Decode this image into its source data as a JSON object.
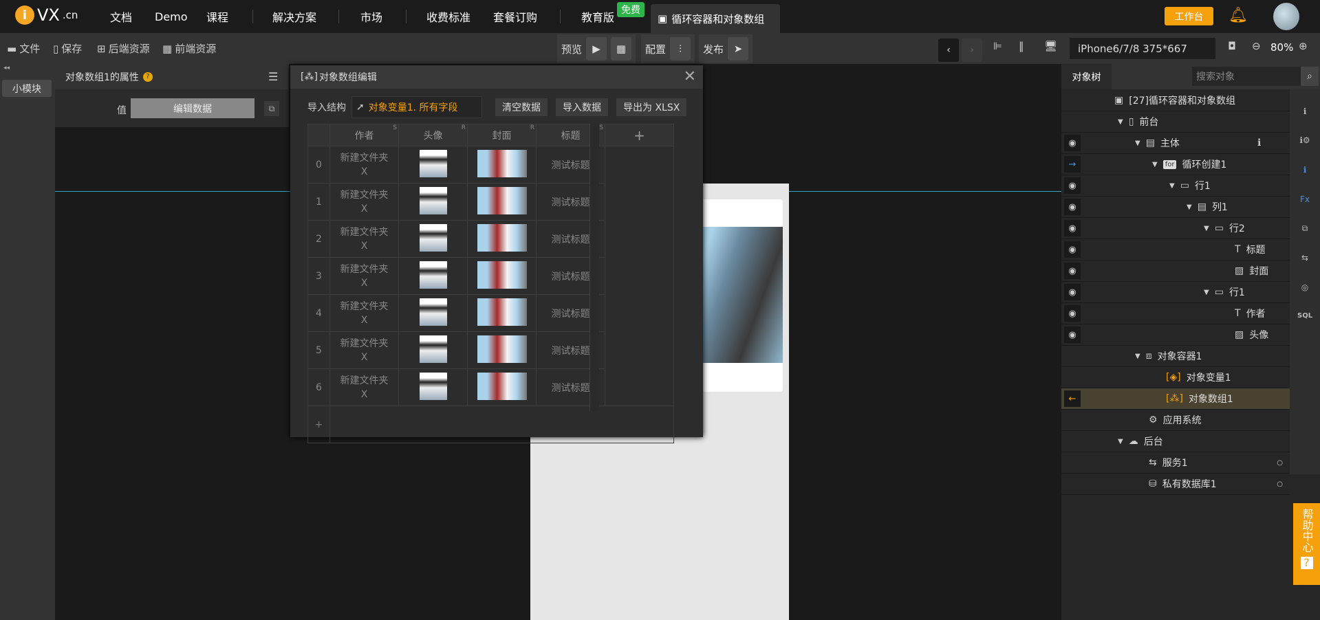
{
  "header": {
    "logo": "VX",
    "logo_suffix": ".cn",
    "nav": [
      "文档",
      "Demo",
      "课程",
      "解决方案",
      "市场",
      "收费标准",
      "套餐订购",
      "教育版"
    ],
    "free_badge": "免费",
    "active_tab": "循环容器和对象数组",
    "workbench": "工作台"
  },
  "toolbar": {
    "file": "文件",
    "save": "保存",
    "backend_res": "后端资源",
    "frontend_res": "前端资源",
    "preview": "预览",
    "config": "配置",
    "publish": "发布",
    "device": "iPhone6/7/8 375*667",
    "zoom": "80%"
  },
  "left": {
    "small_module": "小模块",
    "props_title": "对象数组1的属性",
    "value_label": "值",
    "edit_data": "编辑数据"
  },
  "dialog": {
    "title": "对象数组编辑",
    "import_label": "导入结构",
    "import_value": "对象变量1. 所有字段",
    "clear": "清空数据",
    "import_data": "导入数据",
    "export": "导出为 XLSX",
    "columns": [
      {
        "name": "作者",
        "type": "S"
      },
      {
        "name": "头像",
        "type": "R"
      },
      {
        "name": "封面",
        "type": "R"
      },
      {
        "name": "标题",
        "type": "S"
      }
    ],
    "add_col": "+",
    "add_row": "+",
    "rows": [
      {
        "i": "0",
        "author": "新建文件夹X",
        "title": "测试标题"
      },
      {
        "i": "1",
        "author": "新建文件夹X",
        "title": "测试标题"
      },
      {
        "i": "2",
        "author": "新建文件夹X",
        "title": "测试标题"
      },
      {
        "i": "3",
        "author": "新建文件夹X",
        "title": "测试标题"
      },
      {
        "i": "4",
        "author": "新建文件夹X",
        "title": "测试标题"
      },
      {
        "i": "5",
        "author": "新建文件夹X",
        "title": "测试标题"
      },
      {
        "i": "6",
        "author": "新建文件夹X",
        "title": "测试标题"
      }
    ]
  },
  "right": {
    "tab": "对象树",
    "search_placeholder": "搜索对象",
    "tree": [
      {
        "label": "[27]循环容器和对象数组",
        "icon": "page-icon",
        "depth": 0,
        "eye": false
      },
      {
        "label": "前台",
        "icon": "tablet-icon",
        "depth": 1,
        "tri": true
      },
      {
        "label": "主体",
        "icon": "column-icon",
        "depth": 2,
        "tri": true,
        "eye": true
      },
      {
        "label": "循环创建1",
        "icon": "for-icon",
        "depth": 3,
        "tri": true,
        "arrow": "right"
      },
      {
        "label": "行1",
        "icon": "row-icon",
        "depth": 4,
        "tri": true,
        "eye": true
      },
      {
        "label": "列1",
        "icon": "column-icon",
        "depth": 5,
        "tri": true,
        "eye": true
      },
      {
        "label": "行2",
        "icon": "row-icon",
        "depth": 6,
        "tri": true,
        "eye": true
      },
      {
        "label": "标题",
        "icon": "text-icon",
        "depth": 7,
        "eye": true
      },
      {
        "label": "封面",
        "icon": "image-icon",
        "depth": 7,
        "eye": true
      },
      {
        "label": "行1",
        "icon": "row-icon",
        "depth": 6,
        "tri": true,
        "eye": true
      },
      {
        "label": "作者",
        "icon": "text-icon",
        "depth": 7,
        "eye": true
      },
      {
        "label": "头像",
        "icon": "image-icon",
        "depth": 7,
        "eye": true
      },
      {
        "label": "对象容器1",
        "icon": "box-icon",
        "depth": 2,
        "tri": true
      },
      {
        "label": "对象变量1",
        "icon": "object-var-icon",
        "depth": 3
      },
      {
        "label": "对象数组1",
        "icon": "object-array-icon",
        "depth": 3,
        "arrow": "left",
        "selected": true
      },
      {
        "label": "应用系统",
        "icon": "gear-icon",
        "depth": 2
      },
      {
        "label": "后台",
        "icon": "cloud-server-icon",
        "depth": 1,
        "tri": true
      },
      {
        "label": "服务1",
        "icon": "service-icon",
        "depth": 2,
        "dot": true
      },
      {
        "label": "私有数据库1",
        "icon": "database-icon",
        "depth": 2,
        "dot": true
      }
    ],
    "help": "帮助中心"
  },
  "colors": {
    "accent": "#f6a00c",
    "free": "#2db44a",
    "selected_row": "#4a4230"
  }
}
